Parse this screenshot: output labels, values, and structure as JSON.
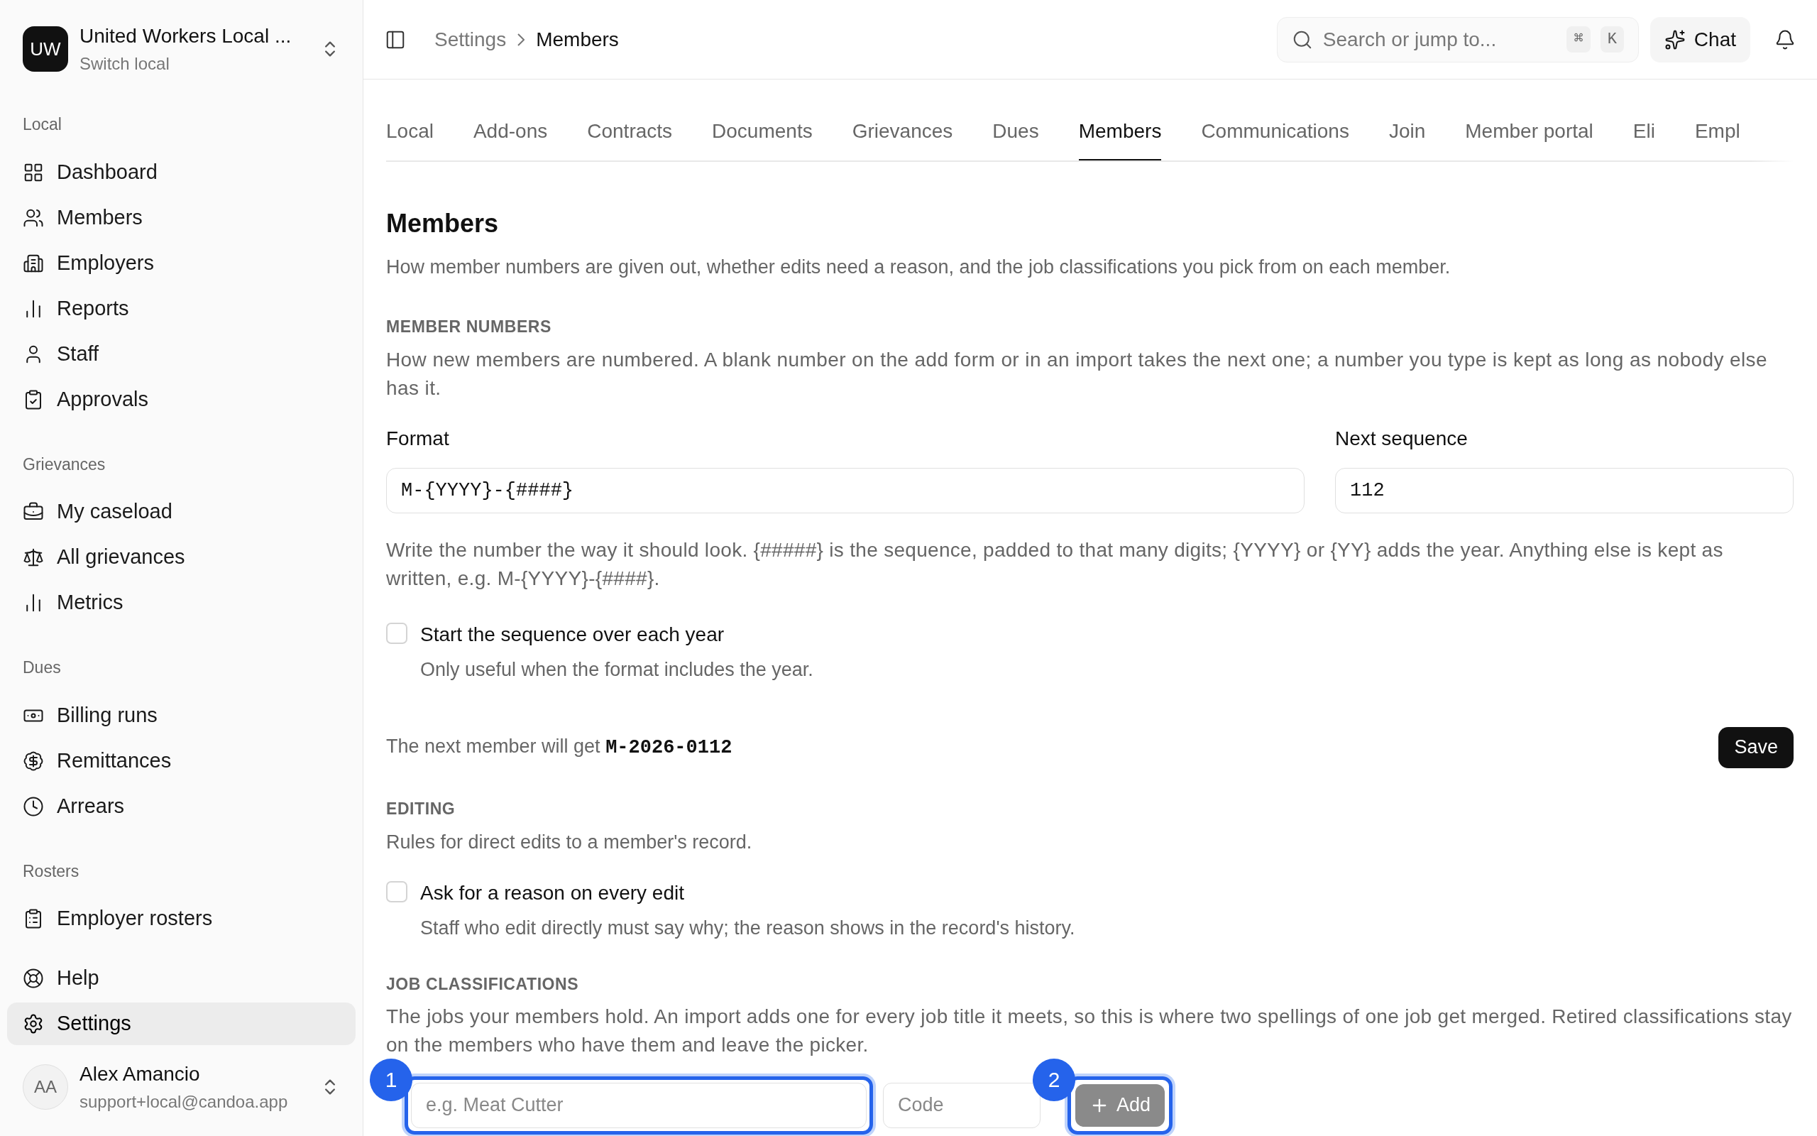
{
  "org": {
    "initials": "UW",
    "name": "United Workers Local ...",
    "subtitle": "Switch local"
  },
  "sidebar": {
    "sections": [
      {
        "title": "Local",
        "items": [
          {
            "label": "Dashboard",
            "selected": false
          },
          {
            "label": "Members",
            "selected": false
          },
          {
            "label": "Employers",
            "selected": false
          },
          {
            "label": "Reports",
            "selected": false
          },
          {
            "label": "Staff",
            "selected": false
          },
          {
            "label": "Approvals",
            "selected": false
          }
        ]
      },
      {
        "title": "Grievances",
        "items": [
          {
            "label": "My caseload",
            "selected": false
          },
          {
            "label": "All grievances",
            "selected": false
          },
          {
            "label": "Metrics",
            "selected": false
          }
        ]
      },
      {
        "title": "Dues",
        "items": [
          {
            "label": "Billing runs",
            "selected": false
          },
          {
            "label": "Remittances",
            "selected": false
          },
          {
            "label": "Arrears",
            "selected": false
          }
        ]
      },
      {
        "title": "Rosters",
        "items": [
          {
            "label": "Employer rosters",
            "selected": false
          }
        ]
      }
    ],
    "footer_items": [
      {
        "label": "Help",
        "selected": false
      },
      {
        "label": "Settings",
        "selected": true
      }
    ]
  },
  "user": {
    "initials": "AA",
    "name": "Alex Amancio",
    "email": "support+local@candoa.app"
  },
  "breadcrumb": [
    "Settings",
    "Members"
  ],
  "search": {
    "placeholder": "Search or jump to...",
    "keys": [
      "⌘",
      "K"
    ]
  },
  "chat_button": "Chat",
  "tabs": [
    {
      "label": "Local",
      "selected": false
    },
    {
      "label": "Add-ons",
      "selected": false
    },
    {
      "label": "Contracts",
      "selected": false
    },
    {
      "label": "Documents",
      "selected": false
    },
    {
      "label": "Grievances",
      "selected": false
    },
    {
      "label": "Dues",
      "selected": false
    },
    {
      "label": "Members",
      "selected": true
    },
    {
      "label": "Communications",
      "selected": false
    },
    {
      "label": "Join",
      "selected": false
    },
    {
      "label": "Member portal",
      "selected": false
    },
    {
      "label": "Eli",
      "selected": false
    },
    {
      "label": "Empl",
      "selected": false
    }
  ],
  "page": {
    "title": "Members",
    "description": "How member numbers are given out, whether edits need a reason, and the job classifications you pick from on each member."
  },
  "member_numbers": {
    "heading": "MEMBER NUMBERS",
    "description": "How new members are numbered. A blank number on the add form or in an import takes the next one; a number you type is kept as long as nobody else has it.",
    "format": {
      "label": "Format",
      "value": "M-{YYYY}-{####}"
    },
    "next_sequence": {
      "label": "Next sequence",
      "value": "112"
    },
    "help": "Write the number the way it should look. {#####} is the sequence, padded to that many digits; {YYYY} or {YY} adds the year. Anything else is kept as written, e.g. M-{YYYY}-{####}.",
    "checkbox": {
      "label": "Start the sequence over each year",
      "hint": "Only useful when the format includes the year.",
      "checked": false
    },
    "preview_label": "The next member will get",
    "preview_value": "M-2026-0112",
    "save_button": "Save"
  },
  "editing": {
    "heading": "EDITING",
    "description": "Rules for direct edits to a member's record.",
    "checkbox": {
      "label": "Ask for a reason on every edit",
      "hint": "Staff who edit directly must say why; the reason shows in the record's history.",
      "checked": false
    }
  },
  "job_classifications": {
    "heading": "JOB CLASSIFICATIONS",
    "description": "The jobs your members hold. An import adds one for every job title it meets, so this is where two spellings of one job get merged. Retired classifications stay on the members who have them and leave the picker.",
    "name_field": {
      "placeholder": "e.g. Meat Cutter",
      "callout": "1"
    },
    "code_field": {
      "placeholder": "Code"
    },
    "add_button": {
      "label": "Add",
      "disabled": true,
      "callout": "2"
    }
  }
}
